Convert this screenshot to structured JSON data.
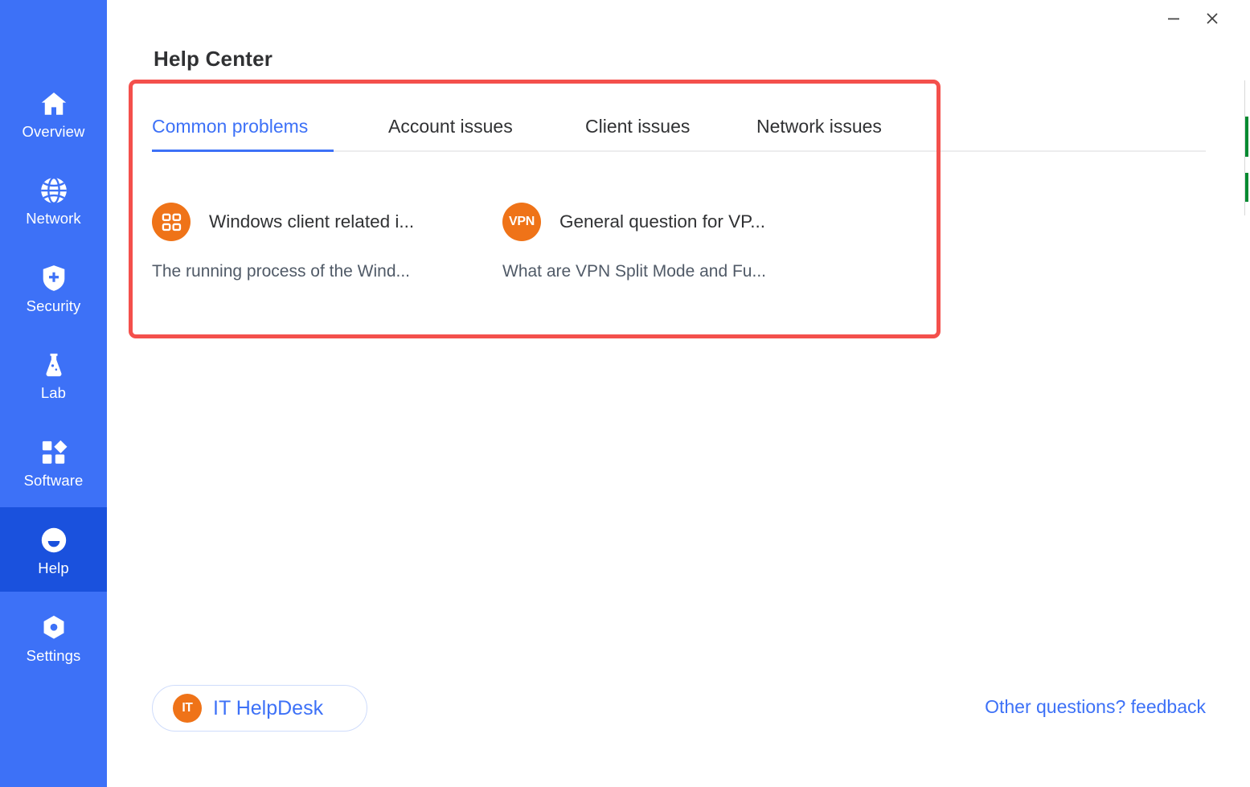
{
  "window": {
    "minimize_label": "–",
    "close_label": "×",
    "minimize_icon": "minimize-icon",
    "close_icon": "close-icon"
  },
  "sidebar": {
    "background_color": "#3d71f7",
    "active_background_color": "#1a51dd",
    "items": [
      {
        "label": "Overview",
        "icon": "home-icon",
        "active": false
      },
      {
        "label": "Network",
        "icon": "globe-icon",
        "active": false
      },
      {
        "label": "Security",
        "icon": "shield-plus-icon",
        "active": false
      },
      {
        "label": "Lab",
        "icon": "flask-icon",
        "active": false
      },
      {
        "label": "Software",
        "icon": "grid-diamond-icon",
        "active": false
      },
      {
        "label": "Help",
        "icon": "smiley-face-icon",
        "active": true
      },
      {
        "label": "Settings",
        "icon": "hexagon-gear-icon",
        "active": false
      }
    ]
  },
  "header": {
    "title": "Help Center"
  },
  "highlight": {
    "color": "#f4504c"
  },
  "tabs": {
    "accent_color": "#3d71f7",
    "items": [
      {
        "label": "Common problems",
        "active": true
      },
      {
        "label": "Account issues",
        "active": false
      },
      {
        "label": "Client issues",
        "active": false
      },
      {
        "label": "Network issues",
        "active": false
      }
    ]
  },
  "cards": [
    {
      "icon": "windows-grid-icon",
      "badge_text": "",
      "badge_color": "#ef7318",
      "title": "Windows client related i...",
      "subtitle": "The running process of the Wind..."
    },
    {
      "icon": "vpn-badge-icon",
      "badge_text": "VPN",
      "badge_color": "#ef7318",
      "title": "General question for VP...",
      "subtitle": "What are VPN Split Mode and Fu..."
    }
  ],
  "footer": {
    "helpdesk_badge_text": "IT",
    "helpdesk_label": "IT HelpDesk",
    "feedback_label": "Other questions? feedback",
    "link_color": "#3d71f7"
  }
}
